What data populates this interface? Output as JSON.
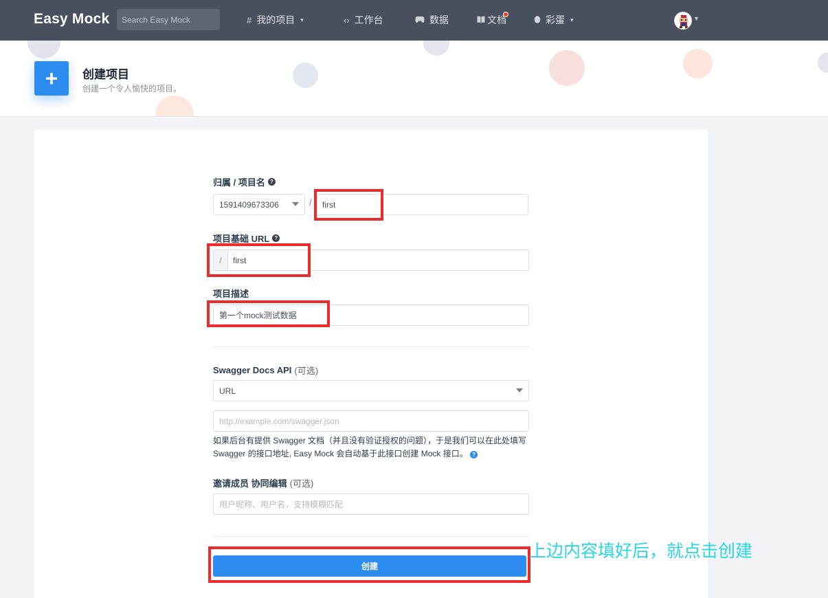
{
  "nav": {
    "logo": "Easy Mock",
    "search_placeholder": "Search Easy Mock",
    "items": [
      {
        "icon": "#",
        "label": "我的项目",
        "has_caret": true
      },
      {
        "icon": "<>",
        "label": "工作台",
        "has_caret": false
      },
      {
        "icon": "gamepad",
        "label": "数据",
        "has_caret": false
      },
      {
        "icon": "book",
        "label": "文档",
        "has_caret": false,
        "notification": true
      },
      {
        "icon": "egg",
        "label": "彩蛋",
        "has_caret": true
      }
    ]
  },
  "header": {
    "title": "创建项目",
    "subtitle": "创建一个令人愉快的项目。"
  },
  "form": {
    "owner_name_label": "归属 / 项目名",
    "owner_value": "1591409673306",
    "project_name_value": "first",
    "base_url_label": "项目基础 URL",
    "base_url_prefix": "/",
    "base_url_value": "first",
    "description_label": "项目描述",
    "description_value": "第一个mock测试数据",
    "swagger_label": "Swagger Docs API",
    "swagger_optional": "(可选)",
    "swagger_type_value": "URL",
    "swagger_url_placeholder": "http://example.com/swagger.json",
    "swagger_help": "如果后台有提供 Swagger 文档（并且没有验证授权的问题），于是我们可以在此处填写 Swagger 的接口地址, Easy Mock 会自动基于此接口创建 Mock 接口。",
    "invite_label": "邀请成员 协同编辑",
    "invite_optional": "(可选)",
    "invite_placeholder": "用户昵称、用户名，支持模糊匹配",
    "create_button": "创建"
  },
  "annotation": {
    "text": "上边内容填好后，就点击创建",
    "highlight_color": "#ee2b2b",
    "text_color": "#2ad6e6"
  },
  "colors": {
    "nav_bg": "#4a4f5e",
    "primary": "#2d8cf0"
  }
}
